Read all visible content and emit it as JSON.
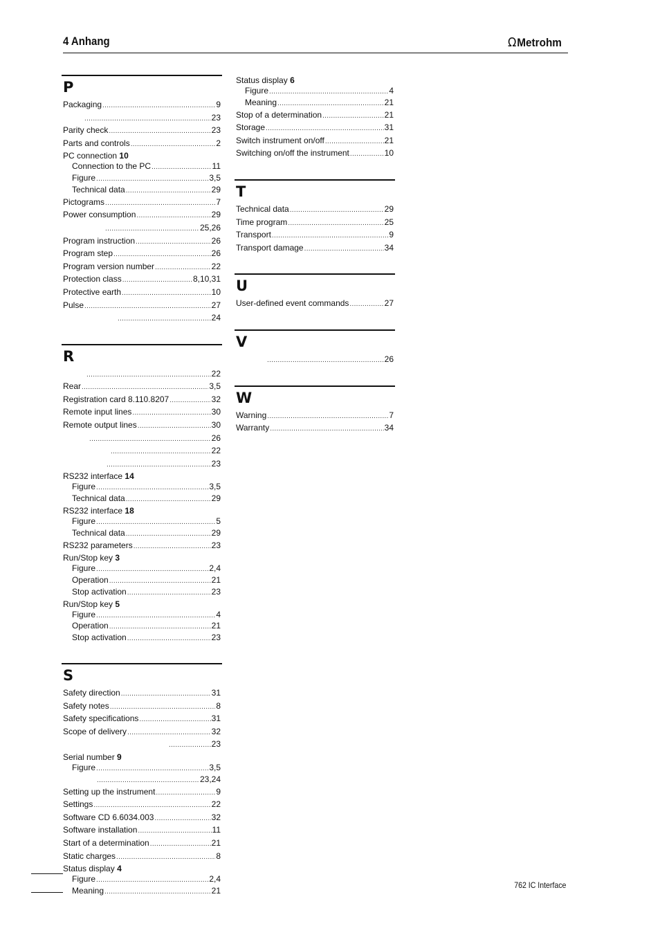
{
  "header": {
    "title": "4 Anhang",
    "logo_text": "Metrohm",
    "logo_icon": "omega-icon",
    "logo_glyph": "Ω"
  },
  "footer": {
    "product": "762 IC Interface"
  },
  "columns": [
    {
      "sections": [
        {
          "letter": "P",
          "entries": [
            {
              "label": "Packaging",
              "page": "9"
            },
            {
              "label": "",
              "indent": 30,
              "page": "23"
            },
            {
              "label": "Parity check",
              "page": "23"
            },
            {
              "label": "Parts and controls",
              "page": "2"
            },
            {
              "label": "PC connection",
              "bold": "10",
              "head": true
            },
            {
              "label": "Connection to the PC",
              "page": "11",
              "sub": true
            },
            {
              "label": "Figure",
              "page": "3,5",
              "sub": true
            },
            {
              "label": "Technical data",
              "page": "29",
              "sub": true
            },
            {
              "label": "Pictograms",
              "page": "7"
            },
            {
              "label": "Power consumption",
              "page": "29"
            },
            {
              "label": "",
              "indent": 60,
              "page": "25,26"
            },
            {
              "label": "Program instruction",
              "page": "26"
            },
            {
              "label": "Program step",
              "page": "26"
            },
            {
              "label": "Program version number",
              "page": "22"
            },
            {
              "label": "Protection class",
              "page": "8,10,31"
            },
            {
              "label": "Protective earth",
              "page": "10"
            },
            {
              "label": "Pulse",
              "page": "27"
            },
            {
              "label": "",
              "indent": 78,
              "page": "24"
            }
          ]
        },
        {
          "letter": "R",
          "entries": [
            {
              "label": "",
              "indent": 33,
              "page": "22"
            },
            {
              "label": "Rear",
              "page": "3,5"
            },
            {
              "label": "Registration card 8.110.8207",
              "page": "32"
            },
            {
              "label": "Remote input lines",
              "page": "30"
            },
            {
              "label": "Remote output lines",
              "page": "30"
            },
            {
              "label": "",
              "indent": 37,
              "page": "26"
            },
            {
              "label": "",
              "indent": 68,
              "page": "22"
            },
            {
              "label": "",
              "indent": 62,
              "page": "23"
            },
            {
              "label": "RS232 interface",
              "bold": "14",
              "head": true
            },
            {
              "label": "Figure",
              "page": "3,5",
              "sub": true
            },
            {
              "label": "Technical data",
              "page": "29",
              "sub": true
            },
            {
              "label": "RS232 interface",
              "bold": "18",
              "head": true
            },
            {
              "label": "Figure",
              "page": "5",
              "sub": true
            },
            {
              "label": "Technical data",
              "page": "29",
              "sub": true
            },
            {
              "label": "RS232 parameters",
              "page": "23"
            },
            {
              "label": "Run/Stop key",
              "bold": "3",
              "head": true
            },
            {
              "label": "Figure",
              "page": "2,4",
              "sub": true
            },
            {
              "label": "Operation",
              "page": "21",
              "sub": true
            },
            {
              "label": "Stop activation",
              "page": "23",
              "sub": true
            },
            {
              "label": "Run/Stop key",
              "bold": "5",
              "head": true
            },
            {
              "label": "Figure",
              "page": "4",
              "sub": true
            },
            {
              "label": "Operation",
              "page": "21",
              "sub": true
            },
            {
              "label": "Stop activation",
              "page": "23",
              "sub": true
            }
          ]
        },
        {
          "letter": "S",
          "entries": [
            {
              "label": "Safety direction",
              "page": "31"
            },
            {
              "label": "Safety notes",
              "page": "8"
            },
            {
              "label": "Safety specifications",
              "page": "31"
            },
            {
              "label": "Scope of delivery",
              "page": "32"
            },
            {
              "label": "",
              "indent": 152,
              "page": "23"
            },
            {
              "label": "Serial number",
              "bold": "9",
              "head": true
            },
            {
              "label": "Figure",
              "page": "3,5",
              "sub": true
            },
            {
              "label": "",
              "indent": 35,
              "page": "23,24",
              "sub": true
            },
            {
              "label": "Setting up the instrument",
              "page": "9"
            },
            {
              "label": "Settings",
              "page": "22"
            },
            {
              "label": "Software CD 6.6034.003",
              "page": "32"
            },
            {
              "label": "Software installation",
              "page": "11"
            },
            {
              "label": "Start of a determination",
              "page": "21"
            },
            {
              "label": "Static charges",
              "page": "8"
            },
            {
              "label": "Status display",
              "bold": "4",
              "head": true
            },
            {
              "label": "Figure",
              "page": "2,4",
              "sub": true
            },
            {
              "label": "Meaning",
              "page": "21",
              "sub": true
            }
          ]
        }
      ]
    },
    {
      "sections": [
        {
          "letter": "",
          "entries": [
            {
              "label": "Status display",
              "bold": "6",
              "head": true
            },
            {
              "label": "Figure",
              "page": "4",
              "sub": true
            },
            {
              "label": "Meaning",
              "page": "21",
              "sub": true
            },
            {
              "label": "Stop of a determination",
              "page": "21"
            },
            {
              "label": "Storage",
              "page": "31"
            },
            {
              "label": "Switch instrument on/off",
              "page": "21"
            },
            {
              "label": "Switching on/off the instrument",
              "page": "10"
            }
          ]
        },
        {
          "letter": "T",
          "entries": [
            {
              "label": "Technical data",
              "page": "29"
            },
            {
              "label": "Time program",
              "page": "25"
            },
            {
              "label": "Transport",
              "page": "9"
            },
            {
              "label": "Transport damage",
              "page": "34"
            }
          ]
        },
        {
          "letter": "U",
          "entries": [
            {
              "label": "User-defined event commands",
              "page": "27"
            }
          ]
        },
        {
          "letter": "V",
          "entries": [
            {
              "label": "",
              "indent": 44,
              "page": "26"
            }
          ]
        },
        {
          "letter": "W",
          "entries": [
            {
              "label": "Warning",
              "page": "7"
            },
            {
              "label": "Warranty",
              "page": "34"
            }
          ]
        }
      ]
    }
  ]
}
